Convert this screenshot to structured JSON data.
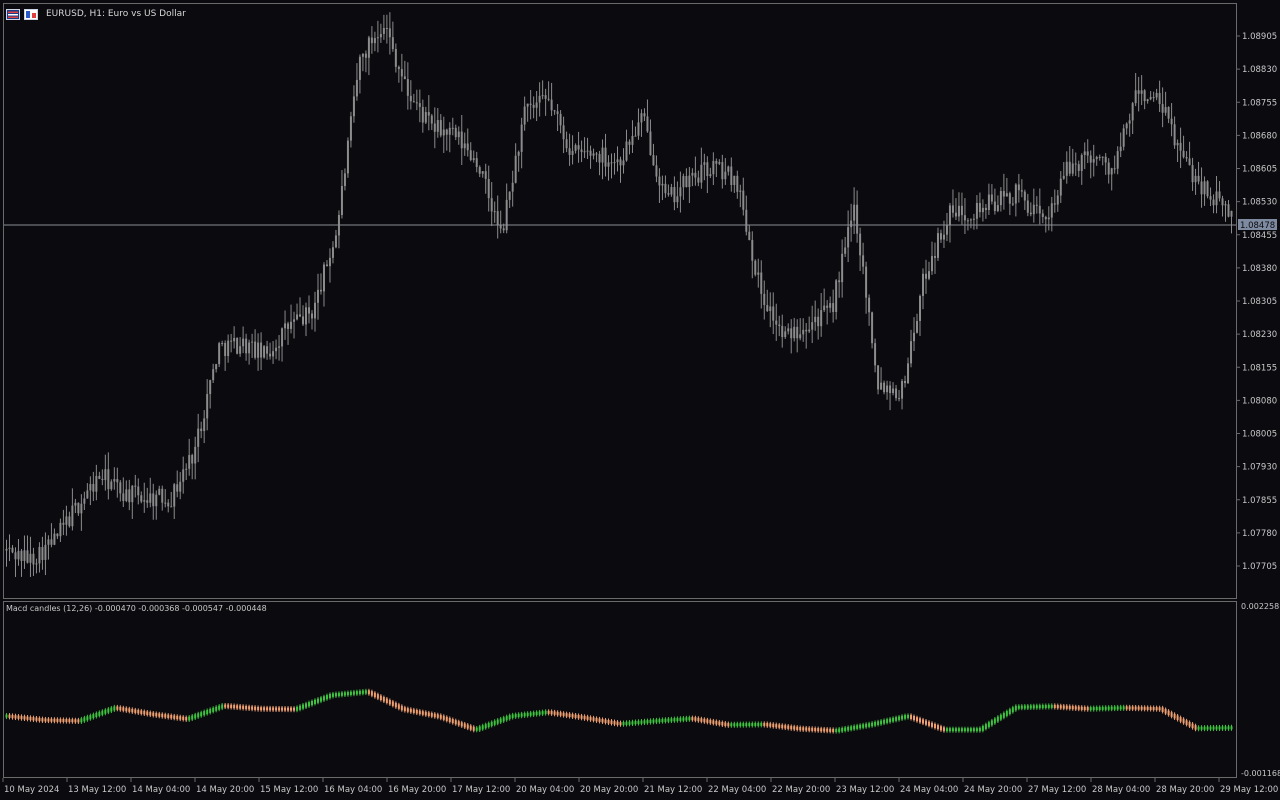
{
  "window": {
    "symbol_title": "EURUSD, H1:  Euro vs US Dollar",
    "icons": [
      "chart-menu-icon",
      "one-click-trading-icon"
    ]
  },
  "indicator": {
    "title": "Macd candles (12,26) -0.000470 -0.000368 -0.000547 -0.000448",
    "axis_labels": [
      "0.002258",
      "-0.001168"
    ],
    "range": [
      -0.001168,
      0.002258
    ]
  },
  "colors": {
    "background": "#0a0a0f",
    "price_candle": "#8c8c8c",
    "bull": "#3ec43e",
    "bear": "#f0a070",
    "frame": "#6a6a6a",
    "price_line": "#8a8f96",
    "current_price_bg": "#7e8aa0"
  },
  "price_axis": {
    "labels": [
      "1.08905",
      "1.08830",
      "1.08755",
      "1.08680",
      "1.08605",
      "1.08530",
      "1.08455",
      "1.08380",
      "1.08305",
      "1.08230",
      "1.08155",
      "1.08080",
      "1.08005",
      "1.07930",
      "1.07855",
      "1.07780",
      "1.07705"
    ],
    "range": [
      1.0765,
      1.0899
    ],
    "current_price": "1.08478"
  },
  "time_axis": {
    "labels": [
      "10 May 2024",
      "13 May 12:00",
      "14 May 04:00",
      "14 May 20:00",
      "15 May 12:00",
      "16 May 04:00",
      "16 May 20:00",
      "17 May 12:00",
      "20 May 04:00",
      "20 May 20:00",
      "21 May 12:00",
      "22 May 04:00",
      "22 May 20:00",
      "23 May 12:00",
      "24 May 04:00",
      "24 May 20:00",
      "27 May 12:00",
      "28 May 04:00",
      "28 May 20:00",
      "29 May 12:00"
    ]
  },
  "chart_data": [
    {
      "type": "candlestick",
      "series_count": 1,
      "path_keypoints": [
        1.0774,
        1.0772,
        1.0776,
        1.0784,
        1.0791,
        1.0787,
        1.0786,
        1.0786,
        1.0797,
        1.082,
        1.0821,
        1.0818,
        1.0825,
        1.0828,
        1.0846,
        1.0885,
        1.0894,
        1.0878,
        1.087,
        1.0868,
        1.0862,
        1.0845,
        1.0873,
        1.0876,
        1.0864,
        1.0864,
        1.0862,
        1.0872,
        1.0853,
        1.0858,
        1.0861,
        1.0858,
        1.0833,
        1.0822,
        1.0826,
        1.0828,
        1.0852,
        1.0812,
        1.081,
        1.0837,
        1.085,
        1.0851,
        1.0853,
        1.0855,
        1.0848,
        1.086,
        1.0864,
        1.086,
        1.0878,
        1.0875,
        1.0862,
        1.0855,
        1.085
      ],
      "ylim": [
        1.0765,
        1.0899
      ]
    },
    {
      "type": "bar",
      "name": "Macd candles (12,26)",
      "path_keypoints": [
        0.0,
        -8e-05,
        -0.0001,
        0.00017,
        4e-05,
        -6e-05,
        0.00021,
        0.00015,
        0.00014,
        0.00043,
        0.0005,
        0.00014,
        -1e-05,
        -0.00028,
        0.0,
        8e-05,
        -3e-05,
        -0.00016,
        -0.0001,
        -5e-05,
        -0.00018,
        -0.00017,
        -0.00026,
        -0.0003,
        -0.00017,
        0.0,
        -0.00028,
        -0.00028,
        0.00018,
        0.0002,
        0.00015,
        0.00017,
        0.00015,
        -0.00025,
        -0.00024
      ],
      "ylim": [
        -0.001168,
        0.002258
      ]
    }
  ]
}
